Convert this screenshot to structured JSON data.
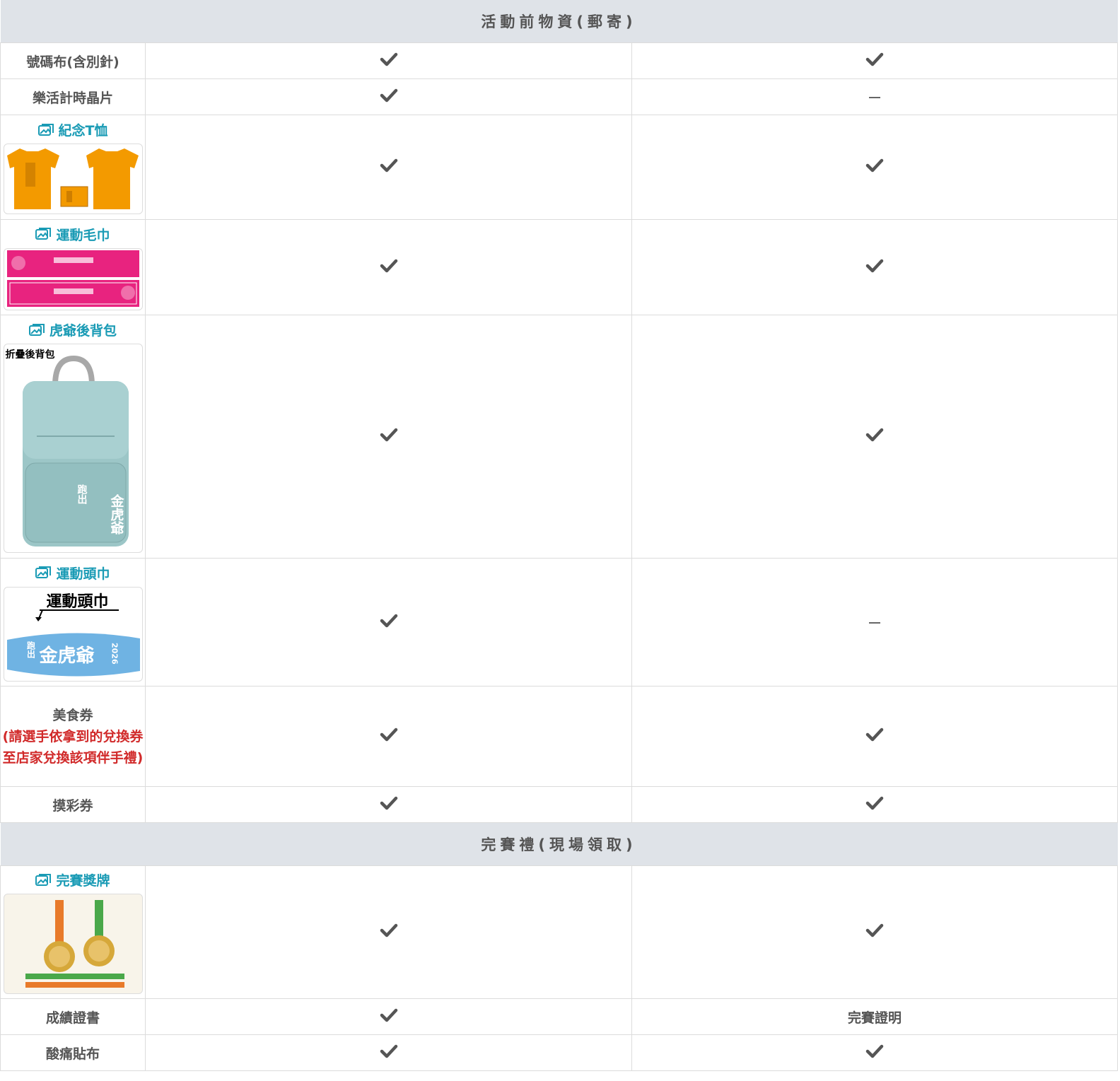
{
  "sections": {
    "pre": "活動前物資(郵寄)",
    "finish": "完賽禮(現場領取)"
  },
  "rows": {
    "bib": "號碼布(含別針)",
    "chip": "樂活計時晶片",
    "tshirt": "紀念T恤",
    "towel": "運動毛巾",
    "backpack": "虎爺後背包",
    "headband": "運動頭巾",
    "food_main": "美食券",
    "food_note": "(請選手依拿到的兌換券至店家兌換該項伴手禮)",
    "lottery": "摸彩券",
    "medal": "完賽獎牌",
    "certificate": "成績證書",
    "patch": "酸痛貼布"
  },
  "cells": {
    "finish_proof": "完賽證明"
  },
  "images": {
    "backpack_caption": "折疊後背包",
    "backpack_text": "金虎爺",
    "backpack_side": "跑出",
    "headband_caption": "運動頭巾",
    "headband_text": "金虎爺",
    "headband_side": "跑出",
    "headband_year": "2026"
  },
  "colors": {
    "section_bg": "#dfe3e8",
    "link": "#1a9bb5",
    "note": "#d12a2a",
    "tshirt": "#f39a00",
    "towel": "#e8237f",
    "backpack": "#9cc6c7",
    "headband": "#6fb3e3"
  }
}
